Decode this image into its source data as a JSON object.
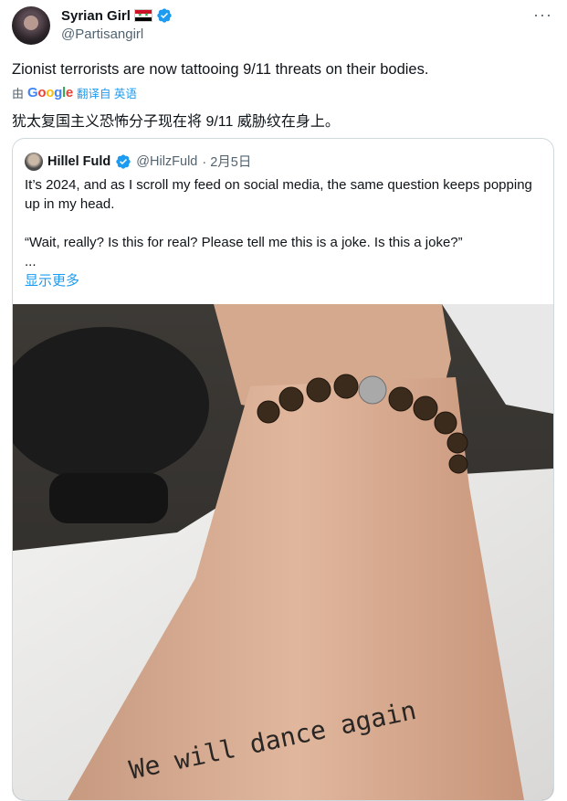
{
  "tweet": {
    "author_name": "Syrian Girl",
    "author_handle": "@Partisangirl",
    "more_menu": "···",
    "text": "Zionist terrorists are now tattooing 9/11 threats on their bodies.",
    "translate_prefix": "由",
    "translate_brand": "Google",
    "translate_link": "翻译自 英语",
    "translated_text": "犹太复国主义恐怖分子现在将 9/11 威胁纹在身上。"
  },
  "quote": {
    "author_name": "Hillel Fuld",
    "author_handle": "@HilzFuld",
    "date": "· 2月5日",
    "line1": "It’s 2024, and as I scroll my feed on social media, the same question keeps popping up in my head.",
    "line2": "“Wait, really? Is this for real? Please tell me this is a joke. Is this a joke?”",
    "ellipsis": "...",
    "show_more": "显示更多"
  },
  "photo": {
    "tattoo_text": "We will dance again"
  },
  "colors": {
    "accent": "#1d9bf0",
    "secondary_text": "#536471",
    "border": "#cfd9de"
  },
  "icons": [
    "verified-badge-icon",
    "syria-flag-icon",
    "more-options-icon"
  ]
}
